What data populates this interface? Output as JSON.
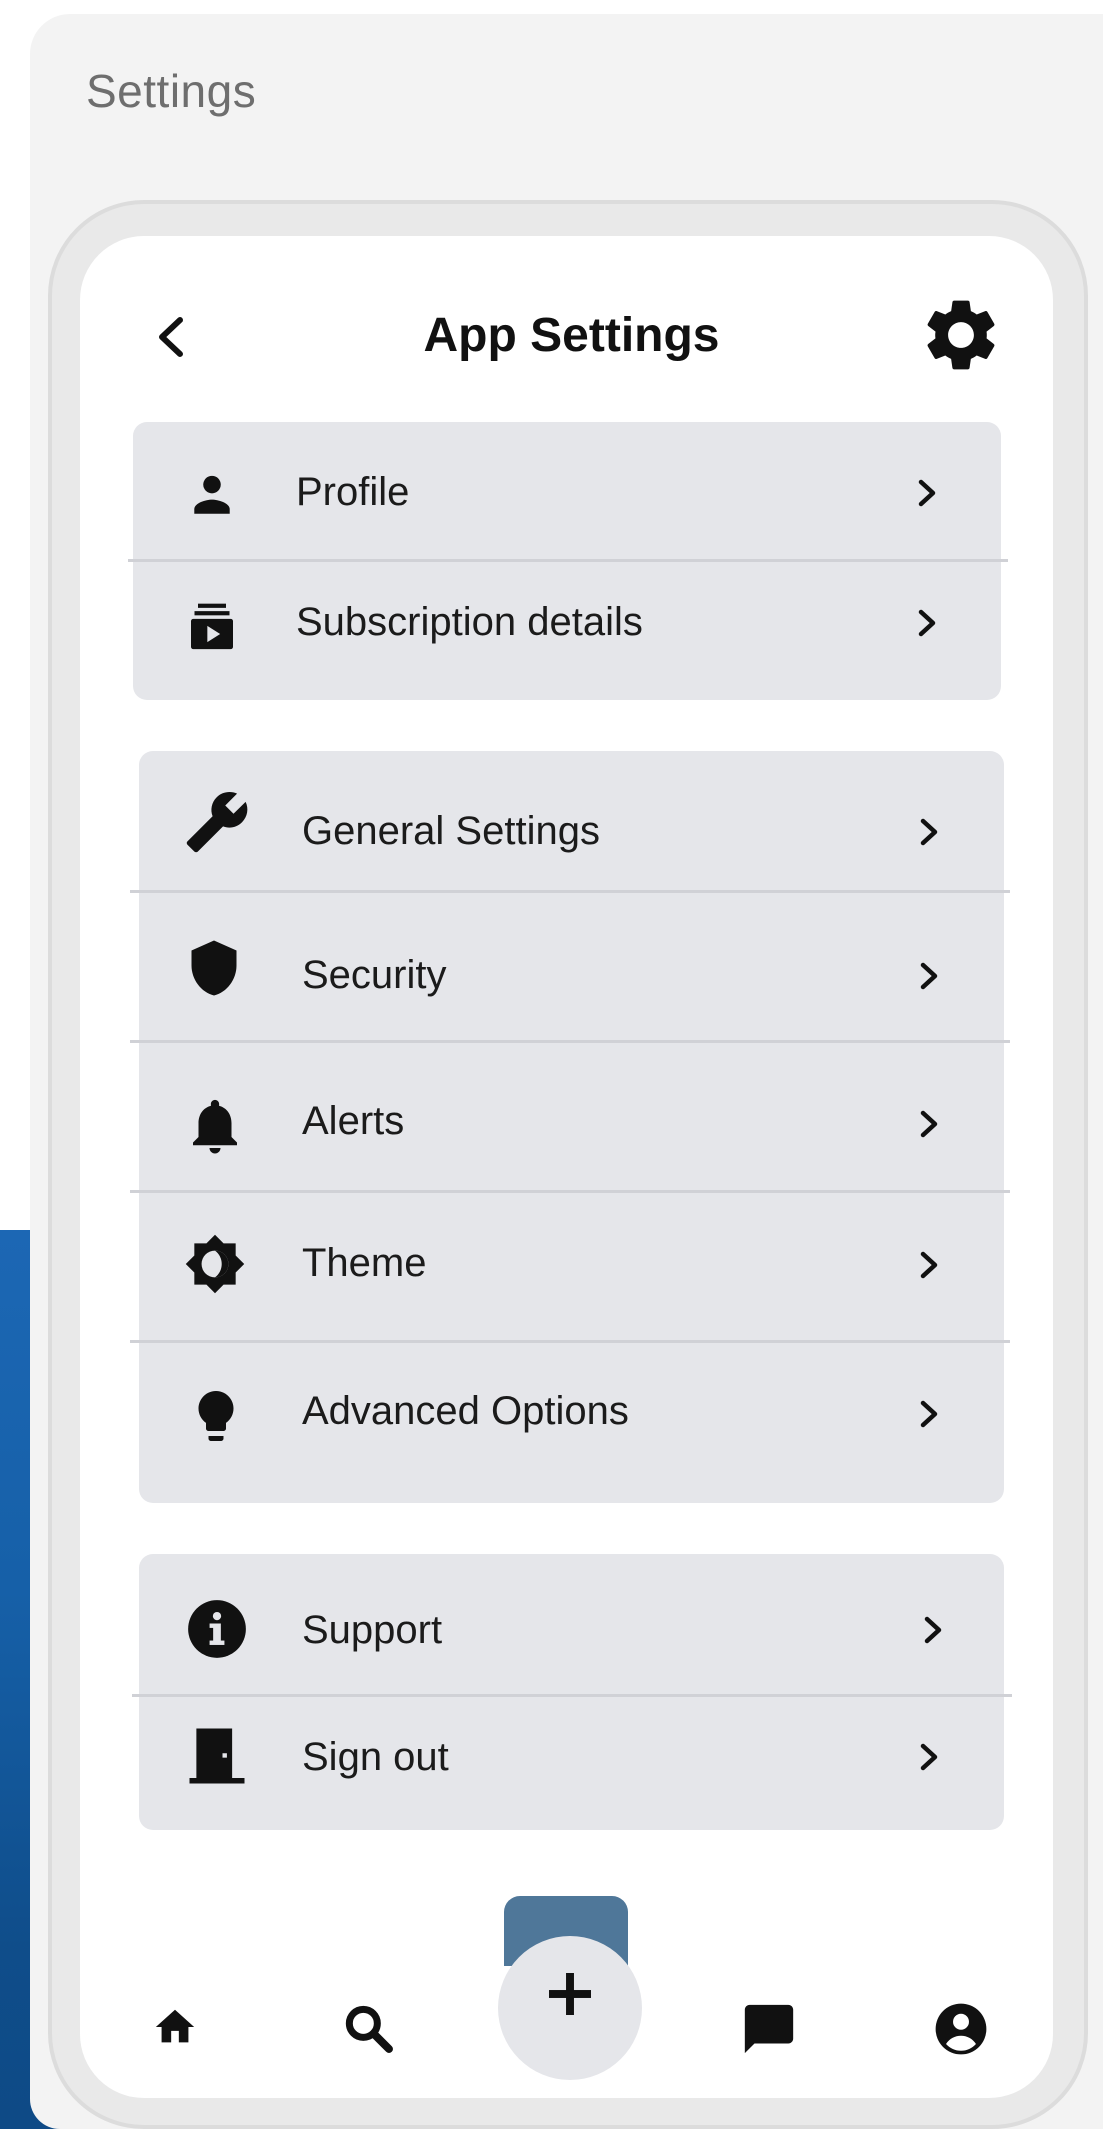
{
  "window": {
    "title": "Settings"
  },
  "header": {
    "title": "App Settings",
    "back_icon": "chevron-left-icon",
    "settings_icon": "gear-icon"
  },
  "groups": [
    {
      "items": [
        {
          "label": "Profile",
          "icon": "person-icon"
        },
        {
          "label": "Subscription details",
          "icon": "subscription-icon"
        }
      ]
    },
    {
      "items": [
        {
          "label": "General Settings",
          "icon": "wrench-icon"
        },
        {
          "label": "Security",
          "icon": "shield-icon"
        },
        {
          "label": "Alerts",
          "icon": "bell-icon"
        },
        {
          "label": "Theme",
          "icon": "brightness-icon"
        },
        {
          "label": "Advanced Options",
          "icon": "lightbulb-icon"
        }
      ]
    },
    {
      "items": [
        {
          "label": "Support",
          "icon": "info-icon"
        },
        {
          "label": "Sign out",
          "icon": "door-icon"
        }
      ]
    }
  ],
  "bottom_nav": {
    "items": [
      "home-icon",
      "search-icon",
      "add-icon",
      "chat-icon",
      "account-icon"
    ],
    "fab_label": "+"
  },
  "colors": {
    "group_bg": "#e5e6ea",
    "fab_tab": "#4f7799",
    "background_blue": "#1660a8"
  }
}
